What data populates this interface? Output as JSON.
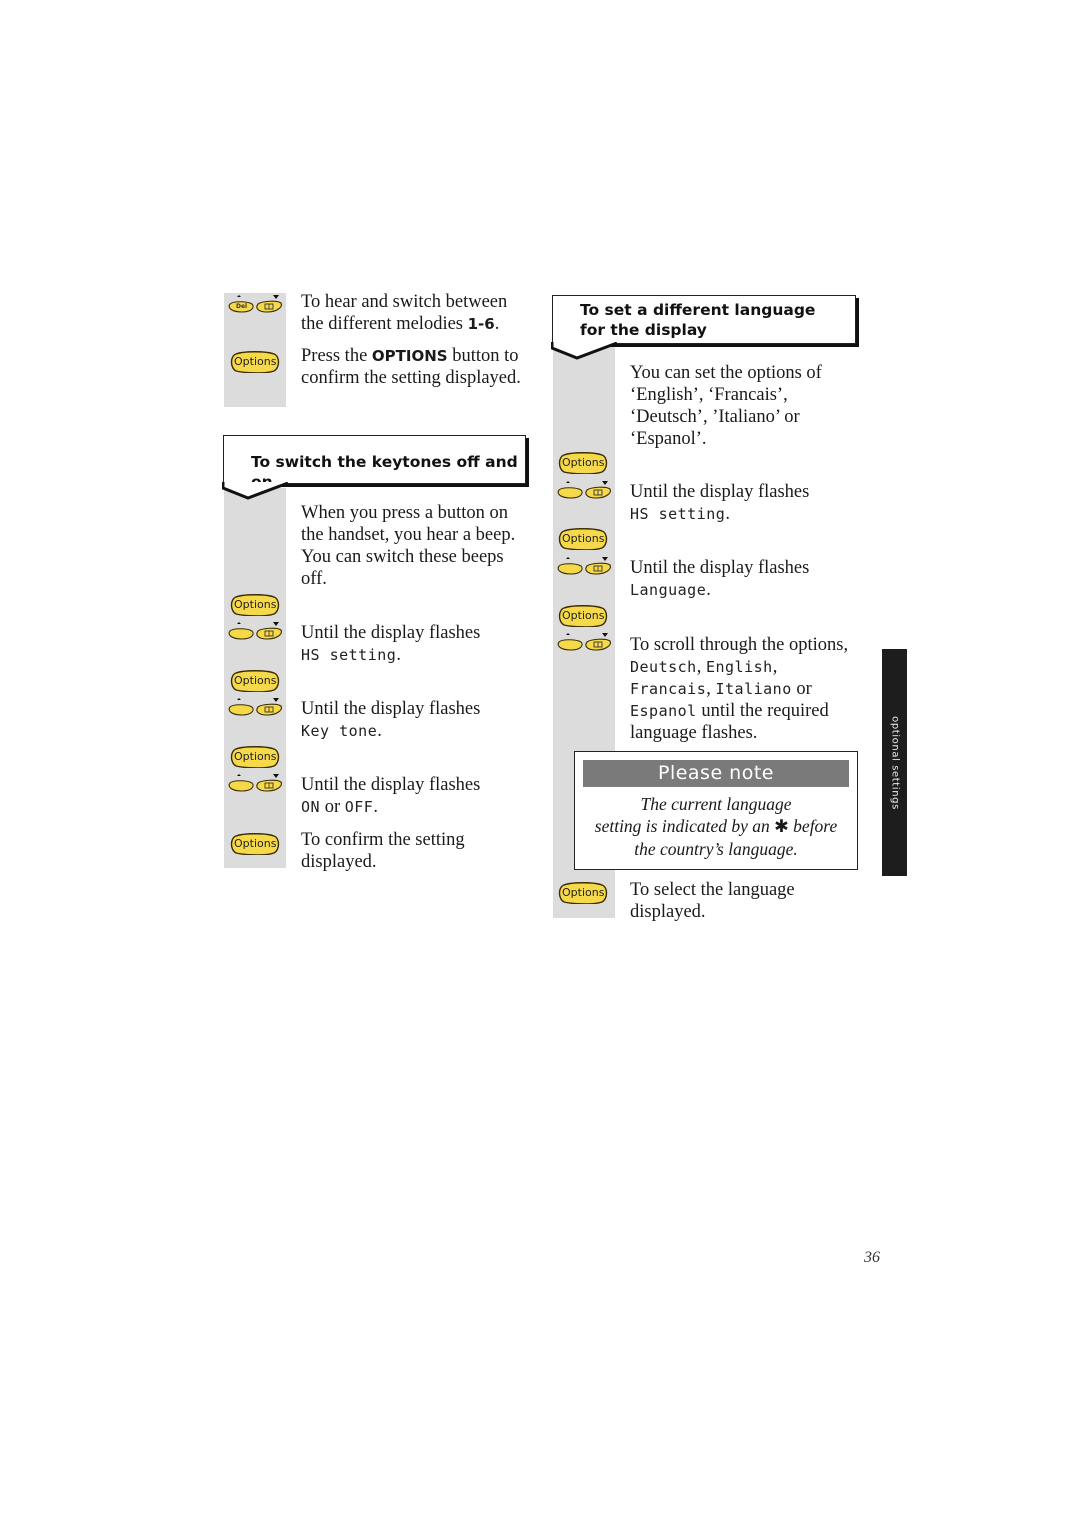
{
  "page": {
    "number": "36",
    "side_tab_label": "optional settings"
  },
  "icons": {
    "options_label": "Options",
    "del_label": "Del"
  },
  "left_column": {
    "intro_steps": [
      {
        "icon": "nav-keys",
        "text_parts": [
          "To hear and switch between the different melodies ",
          "1-6",
          "."
        ]
      },
      {
        "icon": "options-button",
        "text_parts": [
          "Press the ",
          "OPTIONS",
          " button to confirm the setting displayed."
        ]
      }
    ],
    "keytones_section": {
      "heading": "To switch the keytones off and on",
      "intro": "When you press a button on the handset, you hear a beep. You can switch these beeps off.",
      "steps": [
        {
          "icon": "options-button",
          "text": ""
        },
        {
          "icon": "nav-keys",
          "text": "Until the display flashes",
          "lcd": "HS setting",
          "suffix": "."
        },
        {
          "icon": "options-button",
          "text": ""
        },
        {
          "icon": "nav-keys",
          "text": "Until the display flashes",
          "lcd": "Key tone",
          "suffix": "."
        },
        {
          "icon": "options-button",
          "text": ""
        },
        {
          "icon": "nav-keys",
          "text": "Until the display flashes",
          "lcd_on": "ON",
          "or": " or ",
          "lcd_off": "OFF",
          "suffix": "."
        },
        {
          "icon": "options-button",
          "text": "To confirm the setting displayed."
        }
      ]
    }
  },
  "right_column": {
    "language_section": {
      "heading": "To set a different language for the display",
      "intro": "You can set the options of ‘English’, ‘Francais’, ‘Deutsch’, ’Italiano’ or ‘Espanol’.",
      "steps": [
        {
          "icon": "options-button",
          "text": ""
        },
        {
          "icon": "nav-keys",
          "text": "Until the display flashes",
          "lcd": "HS setting",
          "suffix": "."
        },
        {
          "icon": "options-button",
          "text": ""
        },
        {
          "icon": "nav-keys",
          "text": "Until the display flashes",
          "lcd": "Language",
          "suffix": "."
        },
        {
          "icon": "options-button",
          "text": ""
        },
        {
          "icon": "nav-keys",
          "text": "To scroll through the options,",
          "lcd_options": [
            "Deutsch",
            "English",
            "Francais",
            "Italiano",
            "Espanol"
          ],
          "sep1": ", ",
          "sep2": ",",
          "or": " or ",
          "suffix": " until the required language flashes."
        },
        {
          "icon": "options-button",
          "text": "To select the language displayed."
        }
      ]
    },
    "note": {
      "title": "Please note",
      "line1": "The current language",
      "line2_before": "setting is indicated by an ",
      "line2_symbol": "✱",
      "line2_after": " before",
      "line3": "the country’s language."
    }
  }
}
